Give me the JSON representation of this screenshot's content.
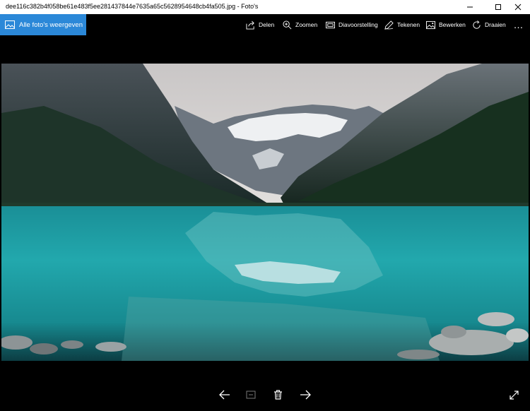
{
  "window": {
    "title": "dee116c382b4f058be61e483f5ee281437844e7635a65c5628954648cb4fa505.jpg - Foto's"
  },
  "toolbar": {
    "all_photos_label": "Alle foto's weergeven",
    "share_label": "Delen",
    "zoom_label": "Zoomen",
    "slideshow_label": "Diavoorstelling",
    "draw_label": "Tekenen",
    "edit_label": "Bewerken",
    "rotate_label": "Draaien",
    "more_label": "…"
  },
  "colors": {
    "accent": "#2b88d8",
    "background": "#000000",
    "water": "#1fa3a8",
    "sky": "#d8d4d3"
  },
  "icons": [
    "minimize-icon",
    "maximize-icon",
    "close-icon",
    "photos-icon",
    "share-icon",
    "zoom-icon",
    "slideshow-icon",
    "pen-icon",
    "edit-icon",
    "rotate-icon",
    "more-icon",
    "arrow-left-icon",
    "filmstrip-icon",
    "delete-icon",
    "arrow-right-icon",
    "fullscreen-icon"
  ]
}
